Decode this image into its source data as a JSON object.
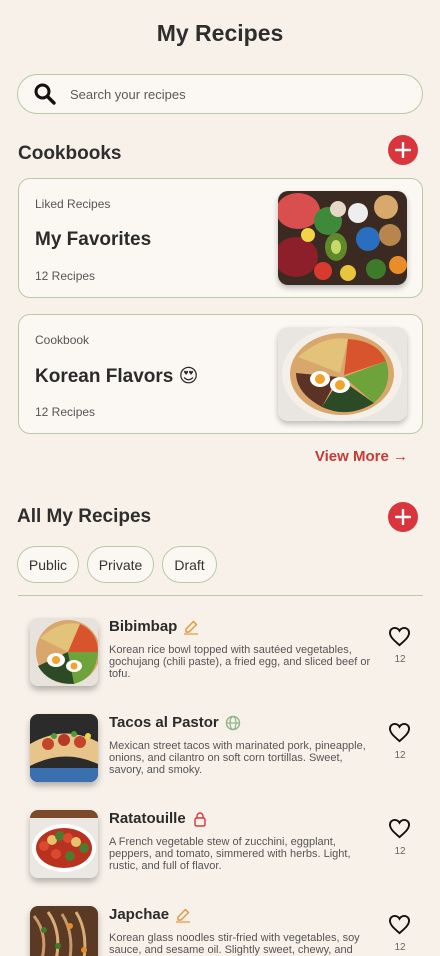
{
  "page": {
    "title": "My Recipes"
  },
  "search": {
    "placeholder": "Search your recipes"
  },
  "cookbooks": {
    "title": "Cookbooks",
    "items": [
      {
        "kind": "Liked Recipes",
        "name": "My Favorites",
        "count": "12 Recipes",
        "image": "vegetables-photo"
      },
      {
        "kind": "Cookbook",
        "name": "Korean Flavors 😍",
        "count": "12 Recipes",
        "image": "bibimbap-photo"
      }
    ],
    "view_more": "View More →"
  },
  "all_recipes": {
    "title": "All My Recipes",
    "filters": [
      "Public",
      "Private",
      "Draft"
    ],
    "items": [
      {
        "name": "Bibimbap",
        "status_icon": "edit-icon",
        "description": "Korean rice bowl topped with sautéed vegetables, gochujang (chili paste), a fried egg, and sliced beef or tofu.",
        "likes": "12"
      },
      {
        "name": "Tacos al Pastor",
        "status_icon": "globe-icon",
        "description": "Mexican street tacos with marinated pork, pineapple, onions, and cilantro on soft corn tortillas. Sweet, savory, and smoky.",
        "likes": "12"
      },
      {
        "name": "Ratatouille",
        "status_icon": "lock-icon",
        "description": "A French vegetable stew of zucchini, eggplant, peppers, and tomato, simmered with herbs. Light, rustic, and full of flavor.",
        "likes": "12"
      },
      {
        "name": "Japchae",
        "status_icon": "edit-icon",
        "description": "Korean glass noodles stir-fried with vegetables, soy sauce, and sesame oil. Slightly sweet, chewy, and",
        "likes": "12"
      }
    ]
  },
  "colors": {
    "accent": "#d8363c",
    "border": "#b9c9a7",
    "background": "#f8f1ea",
    "edit": "#e8963a",
    "public": "#8fb58a",
    "private": "#d8363c"
  }
}
